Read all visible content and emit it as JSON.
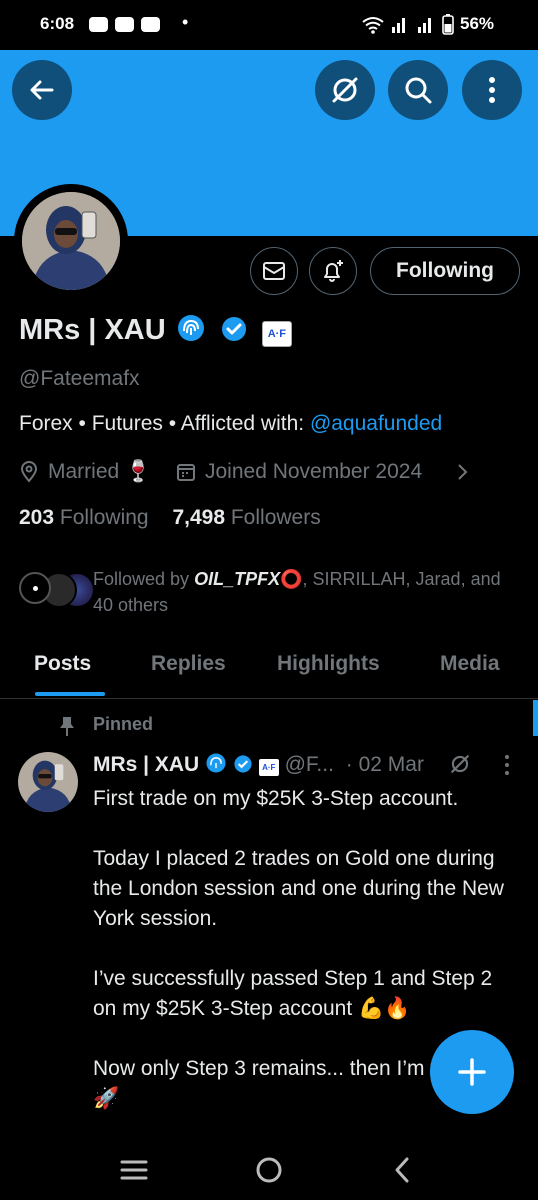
{
  "status_bar": {
    "time": "6:08",
    "battery": "56%"
  },
  "profile": {
    "name": "MRs | XAU",
    "handle": "@Fateemafx",
    "bio_text": "Forex • Futures • Afflicted with: ",
    "bio_link": "@aquafunded",
    "location": "Married",
    "joined": "Joined November 2024",
    "following_count": "203",
    "following_label": "Following",
    "followers_count": "7,498",
    "followers_label": "Followers",
    "followed_by_prefix": "Followed by ",
    "followed_by_first": "OIL_TPFX",
    "followed_by_rest": ", SIRRILLAH, Jarad, and 40 others",
    "affiliate_badge": "A·F",
    "follow_button": "Following"
  },
  "tabs": [
    {
      "label": "Posts"
    },
    {
      "label": "Replies"
    },
    {
      "label": "Highlights"
    },
    {
      "label": "Media"
    }
  ],
  "pinned_tweet": {
    "pinned_label": "Pinned",
    "author_name": "MRs | XAU",
    "author_handle": "@F...",
    "date": "· 02 Mar",
    "p1": "First trade on my $25K 3-Step account.",
    "p2": "Today I placed 2 trades on Gold one during the London session and one during the New York session.",
    "p3": "I’ve successfully passed Step 1 and Step 2 on my $25K 3-Step account 💪🔥",
    "p4": "Now only Step 3 remains... then I’m funded! 🚀"
  },
  "colors": {
    "accent": "#1d9bf0",
    "background": "#000000",
    "muted": "#71767b"
  }
}
